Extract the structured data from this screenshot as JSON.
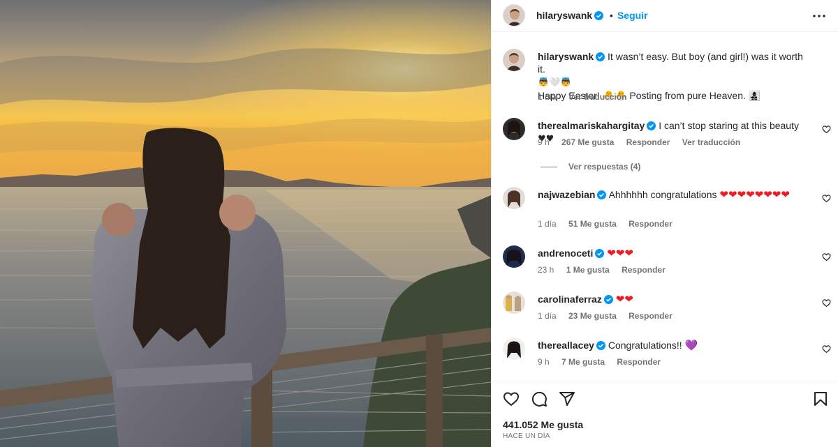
{
  "post": {
    "author": "hilaryswank",
    "follow_label": "Seguir",
    "dot": "•",
    "caption_line1": "It wasn’t easy. But boy (and girl!) was it worth it.",
    "caption_emojis": "👼🤍👼",
    "caption_line2": "Happy Easter! 🐣🐣 Posting from pure Heaven. 👩‍👧‍👦",
    "caption_age": "1 día",
    "caption_translate": "Ver traducción"
  },
  "comments": [
    {
      "user": "therealmariskahargitay",
      "text": "I can’t stop staring at this beauty",
      "emojis": "♥♥",
      "age": "9 h",
      "likes": "267 Me gusta",
      "reply": "Responder",
      "translate": "Ver traducción"
    },
    {
      "user": "najwazebian",
      "text": "Ahhhhhh congratulations",
      "emojis": "❤❤❤❤❤❤❤❤",
      "age": "1 día",
      "likes": "51 Me gusta",
      "reply": "Responder"
    },
    {
      "user": "andrenoceti",
      "text": "",
      "emojis": "❤❤❤",
      "age": "23 h",
      "likes": "1 Me gusta",
      "reply": "Responder"
    },
    {
      "user": "carolinaferraz",
      "text": "",
      "emojis": "❤❤",
      "age": "1 día",
      "likes": "23 Me gusta",
      "reply": "Responder"
    },
    {
      "user": "thereallacey",
      "text": "Congratulations!!",
      "emojis": "💜",
      "age": "9 h",
      "likes": "7 Me gusta",
      "reply": "Responder"
    }
  ],
  "view_replies": "Ver respuestas (4)",
  "footer": {
    "likes": "441.052 Me gusta",
    "time": "HACE UN DÍA"
  },
  "icons": {
    "verified": "verified-badge-icon",
    "more": "more-options-icon",
    "like": "heart-icon",
    "comment": "comment-icon",
    "share": "send-icon",
    "save": "bookmark-icon"
  },
  "colors": {
    "accent": "#0095f6",
    "text": "#262626",
    "muted": "#737373",
    "heart": "#ed1c24"
  }
}
